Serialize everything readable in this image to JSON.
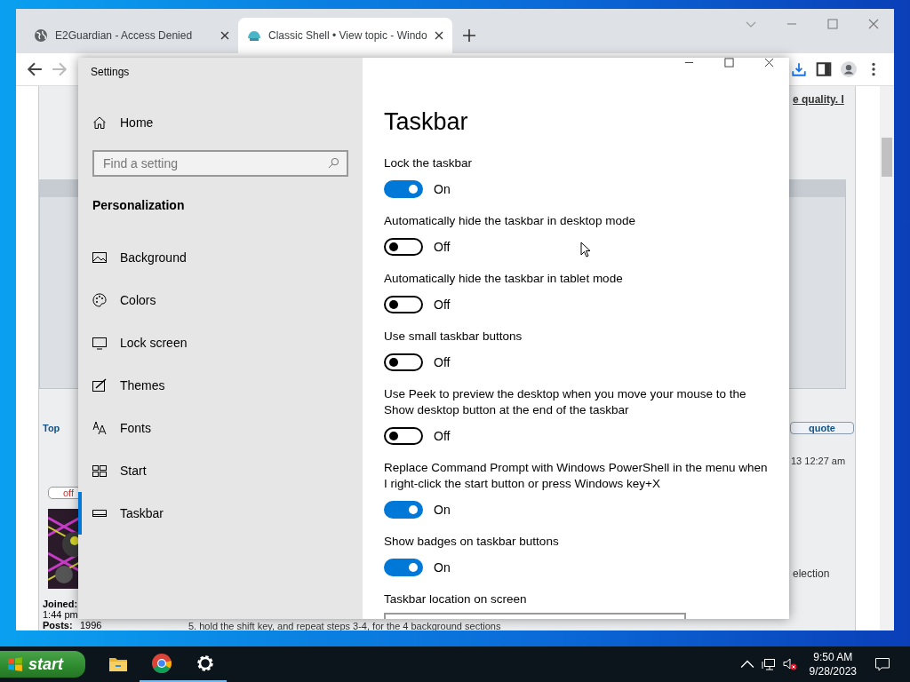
{
  "browser": {
    "tabs": [
      {
        "title": "E2Guardian - Access Denied",
        "selected": false
      },
      {
        "title": "Classic Shell • View topic - Windo",
        "selected": true
      }
    ],
    "page": {
      "link_fragment": "e quality. I",
      "top_link": "Top",
      "status_fragment": "off",
      "quote_button": "quote",
      "post_time_fragment": "13 12:27 am",
      "joined_label": "Joined:",
      "joined_time_fragment": "1:44 pm",
      "posts_label": "Posts:",
      "posts_value": "1996",
      "text_fragment": "election",
      "step_text": "5. hold the shift key, and repeat steps 3-4, for the 4 background sections"
    }
  },
  "settings": {
    "title": "Settings",
    "home": "Home",
    "search": {
      "placeholder": "Find a setting"
    },
    "section": "Personalization",
    "nav": [
      {
        "label": "Background",
        "selected": false
      },
      {
        "label": "Colors",
        "selected": false
      },
      {
        "label": "Lock screen",
        "selected": false
      },
      {
        "label": "Themes",
        "selected": false
      },
      {
        "label": "Fonts",
        "selected": false
      },
      {
        "label": "Start",
        "selected": false
      },
      {
        "label": "Taskbar",
        "selected": true
      }
    ],
    "page_title": "Taskbar",
    "options": [
      {
        "label": "Lock the taskbar",
        "on": true,
        "state": "On"
      },
      {
        "label": "Automatically hide the taskbar in desktop mode",
        "on": false,
        "state": "Off"
      },
      {
        "label": "Automatically hide the taskbar in tablet mode",
        "on": false,
        "state": "Off"
      },
      {
        "label": "Use small taskbar buttons",
        "on": false,
        "state": "Off"
      },
      {
        "label": "Use Peek to preview the desktop when you move your mouse to the Show desktop button at the end of the taskbar",
        "on": false,
        "state": "Off"
      },
      {
        "label": "Replace Command Prompt with Windows PowerShell in the menu when I right-click the start button or press Windows key+X",
        "on": true,
        "state": "On"
      },
      {
        "label": "Show badges on taskbar buttons",
        "on": true,
        "state": "On"
      }
    ],
    "location_label": "Taskbar location on screen"
  },
  "taskbar": {
    "start": "start",
    "apps": [
      {
        "kind": "folder",
        "running": false
      },
      {
        "kind": "chrome",
        "running": true
      },
      {
        "kind": "gear",
        "running": true
      }
    ],
    "time": "9:50 AM",
    "date": "9/28/2023"
  }
}
